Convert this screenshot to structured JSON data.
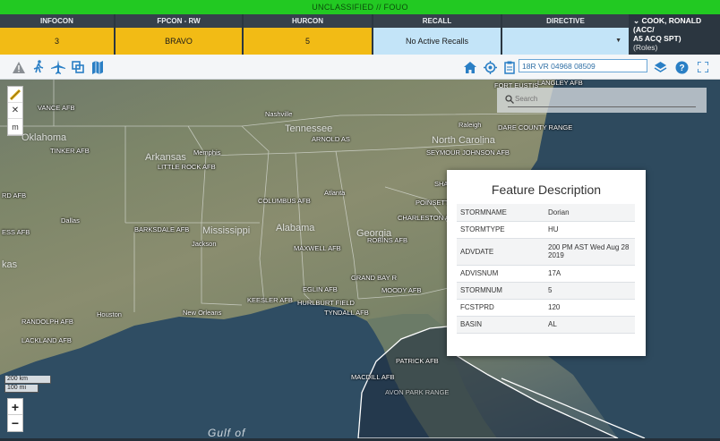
{
  "classification": "UNCLASSIFIED // FOUO",
  "status": {
    "infocon": {
      "label": "INFOCON",
      "value": "3"
    },
    "fpcon": {
      "label": "FPCON - RW",
      "value": "BRAVO"
    },
    "hurcon": {
      "label": "HURCON",
      "value": "5"
    },
    "recall": {
      "label": "RECALL",
      "value": "No Active Recalls"
    },
    "directive": {
      "label": "DIRECTIVE",
      "value": ""
    }
  },
  "user": {
    "caret": "⌄",
    "name": "COOK, RONALD (ACC/",
    "name2": "A5 ACQ SPT)",
    "roles": "(Roles)"
  },
  "toolbar": {
    "mgrs_value": "18R VR 04968 08509"
  },
  "map_search": {
    "placeholder": "Search"
  },
  "scale": {
    "km": "200 km",
    "mi": "100 mi"
  },
  "map_labels": {
    "vance": "VANCE AFB",
    "oklahoma": "Oklahoma",
    "tinker": "TINKER AFB",
    "rd_afb": "RD AFB",
    "arkansas": "Arkansas",
    "little_rock": "LITTLE ROCK AFB",
    "memphis": "Memphis",
    "nashville": "Nashville",
    "tennessee": "Tennessee",
    "arnold": "ARNOLD AS",
    "raleigh": "Raleigh",
    "north_carolina": "North Carolina",
    "seymour": "SEYMOUR JOHNSON AFB",
    "dare_county": "DARE COUNTY RANGE",
    "fort_eustis": "FORT EUSTIS",
    "langley": "LANGLEY AFB",
    "columbus": "COLUMBUS AFB",
    "atlanta": "Atlanta",
    "sha": "SHA",
    "poinsett": "POINSETT",
    "charleston": "CHARLESTON AFB",
    "dallas": "Dallas",
    "ess": "ESS AFB",
    "barksdale": "BARKSDALE AFB",
    "mississippi": "Mississippi",
    "jackson": "Jackson",
    "alabama": "Alabama",
    "maxwell": "MAXWELL AFB",
    "georgia": "Georgia",
    "robins": "ROBINS AFB",
    "kas": "kas",
    "grand_bay": "GRAND BAY R",
    "moody": "MOODY AFB",
    "keesler": "KEESLER AFB",
    "eglin": "EGLIN AFB",
    "hurlburt": "HURLBURT FIELD",
    "tyndall": "TYNDALL AFB",
    "houston": "Houston",
    "new_orleans": "New Orleans",
    "randolph": "RANDOLPH AFB",
    "lackland": "LACKLAND AFB",
    "patrick": "PATRICK AFB",
    "macdill": "MACDILL AFB",
    "avon_park": "AVON PARK RANGE",
    "gulf_of": "Gulf of"
  },
  "feature": {
    "title": "Feature Description",
    "rows": [
      {
        "key": "STORMNAME",
        "value": "Dorian"
      },
      {
        "key": "STORMTYPE",
        "value": "HU"
      },
      {
        "key": "ADVDATE",
        "value": "200 PM AST Wed Aug 28 2019"
      },
      {
        "key": "ADVISNUM",
        "value": "17A"
      },
      {
        "key": "STORMNUM",
        "value": "5"
      },
      {
        "key": "FCSTPRD",
        "value": "120"
      },
      {
        "key": "BASIN",
        "value": "AL"
      }
    ]
  },
  "colors": {
    "banner": "#22c922",
    "yellow": "#f2bb15",
    "recall_bg": "#c3e4f8",
    "toolbar_icon": "#2a7fc5"
  }
}
